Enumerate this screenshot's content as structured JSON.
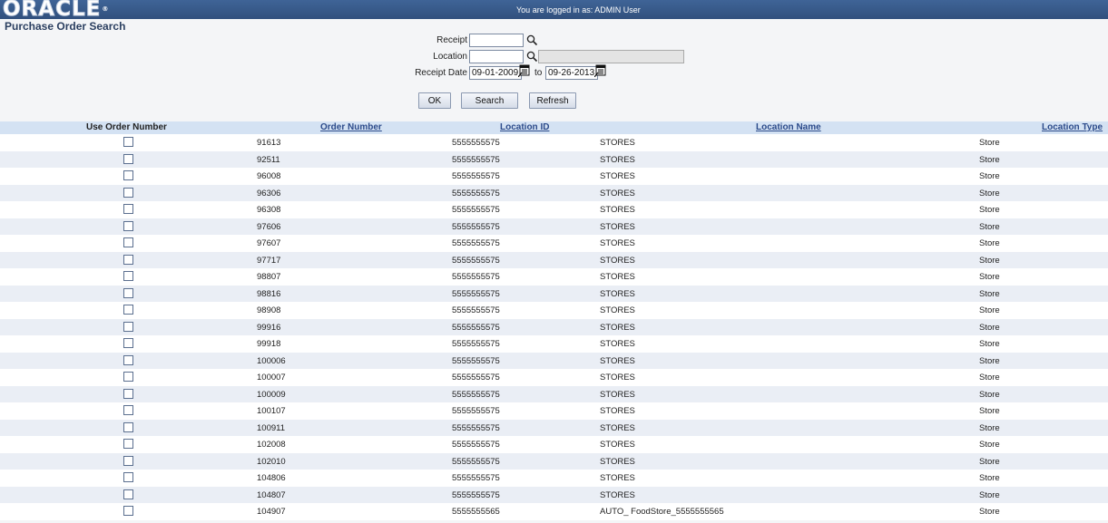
{
  "header": {
    "logo_text": "ORACLE",
    "logo_mark": "®",
    "login_text": "You are logged in as: ADMIN User"
  },
  "page": {
    "title": "Purchase Order Search"
  },
  "form": {
    "receipt_label": "Receipt",
    "receipt_value": "",
    "location_label": "Location",
    "location_value": "",
    "location_desc_value": "",
    "receipt_date_label": "Receipt Date",
    "date_from": "09-01-2009",
    "to_label": "to",
    "date_to": "09-26-2013"
  },
  "buttons": {
    "ok": "OK",
    "search": "Search",
    "refresh": "Refresh"
  },
  "icons": {
    "lookup": "magnifier-icon",
    "calendar": "calendar-icon"
  },
  "colors": {
    "header_bar": "#3a5c8f",
    "table_header": "#d4e2f3",
    "alt_row": "#eaeef5"
  },
  "table": {
    "columns": {
      "use": "Use Order Number",
      "order": "Order Number",
      "locid": "Location ID",
      "locname": "Location Name",
      "loctype": "Location Type"
    },
    "rows": [
      {
        "checked": false,
        "order": "91613",
        "locid": "5555555575",
        "locname": "STORES",
        "loctype": "Store"
      },
      {
        "checked": false,
        "order": "92511",
        "locid": "5555555575",
        "locname": "STORES",
        "loctype": "Store"
      },
      {
        "checked": false,
        "order": "96008",
        "locid": "5555555575",
        "locname": "STORES",
        "loctype": "Store"
      },
      {
        "checked": false,
        "order": "96306",
        "locid": "5555555575",
        "locname": "STORES",
        "loctype": "Store"
      },
      {
        "checked": false,
        "order": "96308",
        "locid": "5555555575",
        "locname": "STORES",
        "loctype": "Store"
      },
      {
        "checked": false,
        "order": "97606",
        "locid": "5555555575",
        "locname": "STORES",
        "loctype": "Store"
      },
      {
        "checked": false,
        "order": "97607",
        "locid": "5555555575",
        "locname": "STORES",
        "loctype": "Store"
      },
      {
        "checked": false,
        "order": "97717",
        "locid": "5555555575",
        "locname": "STORES",
        "loctype": "Store"
      },
      {
        "checked": false,
        "order": "98807",
        "locid": "5555555575",
        "locname": "STORES",
        "loctype": "Store"
      },
      {
        "checked": false,
        "order": "98816",
        "locid": "5555555575",
        "locname": "STORES",
        "loctype": "Store"
      },
      {
        "checked": false,
        "order": "98908",
        "locid": "5555555575",
        "locname": "STORES",
        "loctype": "Store"
      },
      {
        "checked": false,
        "order": "99916",
        "locid": "5555555575",
        "locname": "STORES",
        "loctype": "Store"
      },
      {
        "checked": false,
        "order": "99918",
        "locid": "5555555575",
        "locname": "STORES",
        "loctype": "Store"
      },
      {
        "checked": false,
        "order": "100006",
        "locid": "5555555575",
        "locname": "STORES",
        "loctype": "Store"
      },
      {
        "checked": false,
        "order": "100007",
        "locid": "5555555575",
        "locname": "STORES",
        "loctype": "Store"
      },
      {
        "checked": false,
        "order": "100009",
        "locid": "5555555575",
        "locname": "STORES",
        "loctype": "Store"
      },
      {
        "checked": false,
        "order": "100107",
        "locid": "5555555575",
        "locname": "STORES",
        "loctype": "Store"
      },
      {
        "checked": false,
        "order": "100911",
        "locid": "5555555575",
        "locname": "STORES",
        "loctype": "Store"
      },
      {
        "checked": false,
        "order": "102008",
        "locid": "5555555575",
        "locname": "STORES",
        "loctype": "Store"
      },
      {
        "checked": false,
        "order": "102010",
        "locid": "5555555575",
        "locname": "STORES",
        "loctype": "Store"
      },
      {
        "checked": false,
        "order": "104806",
        "locid": "5555555575",
        "locname": "STORES",
        "loctype": "Store"
      },
      {
        "checked": false,
        "order": "104807",
        "locid": "5555555575",
        "locname": "STORES",
        "loctype": "Store"
      },
      {
        "checked": false,
        "order": "104907",
        "locid": "5555555565",
        "locname": "AUTO_ FoodStore_5555555565",
        "loctype": "Store"
      }
    ]
  }
}
